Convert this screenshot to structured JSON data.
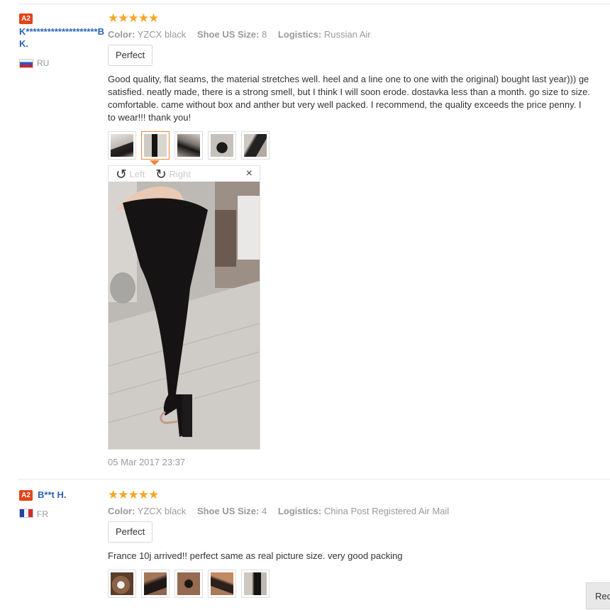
{
  "reviews": [
    {
      "badge": "A2",
      "name_line1": "K********************B",
      "name_line2": "K.",
      "country": "RU",
      "rating_stars": "★★★★★",
      "rating": 5,
      "color_label": "Color:",
      "color_value": "YZCX black",
      "size_label": "Shoe US Size:",
      "size_value": "8",
      "logistics_label": "Logistics:",
      "logistics_value": "Russian Air",
      "tag": "Perfect",
      "text_lines": [
        "Good quality, flat seams, the material stretches well. heel and a line one to one with the original) bought last year))) ge",
        "satisfied. neatly made, there is a strong smell, but I think I will soon erode. dostavka less than a month. go size to size.",
        "comfortable. came without box and anther but very well packed. I recommend, the quality exceeds the price penny. I",
        "to wear!!! thank you!"
      ],
      "viewer": {
        "rotate_left": "Left",
        "rotate_right": "Right",
        "close": "×"
      },
      "date": "05 Mar 2017 23:37"
    },
    {
      "badge": "A2",
      "name_line1": "B**t H.",
      "country": "FR",
      "rating_stars": "★★★★★",
      "rating": 5,
      "color_label": "Color:",
      "color_value": "YZCX black",
      "size_label": "Shoe US Size:",
      "size_value": "4",
      "logistics_label": "Logistics:",
      "logistics_value": "China Post Registered Air Mail",
      "tag": "Perfect",
      "text_lines": [
        "France 10j arrived!! perfect same as real picture size. very good packing"
      ]
    }
  ],
  "report_button": "Rec",
  "colors": {
    "badge": "#e54319",
    "name": "#2a64b5",
    "star": "#f5a623",
    "selected_thumb": "#f08538"
  }
}
